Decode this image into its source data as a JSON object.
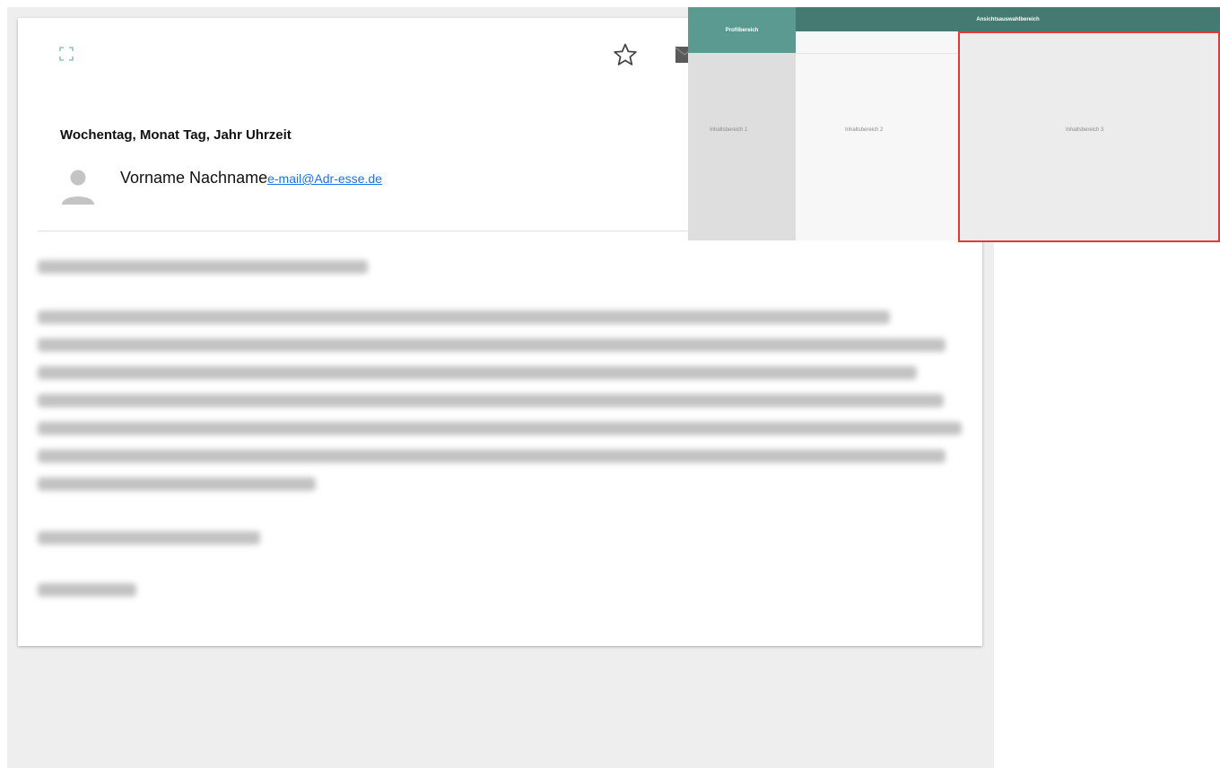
{
  "mail": {
    "date": "Wochentag, Monat Tag, Jahr Uhrzeit",
    "sender": {
      "name": "Vorname Nachname",
      "email_part1": "e-mail@Adr-",
      "email_part2": "esse.de"
    }
  },
  "icons": {
    "expand": "expand-icon",
    "star": "star-icon",
    "mail": "mail-icon",
    "avatar": "person-icon"
  },
  "overlay": {
    "profile_header": "Profilbereich",
    "view_header": "Ansichtsauswahlbereich",
    "content_1": "Inhaltsbereich 1",
    "content_2": "Inhaltsbereich 2",
    "content_3": "Inhaltsbereich 3"
  },
  "colors": {
    "accent": "#5b9a91",
    "accent_dark": "#457a72",
    "link": "#1a73e8",
    "highlight": "#e53935"
  }
}
